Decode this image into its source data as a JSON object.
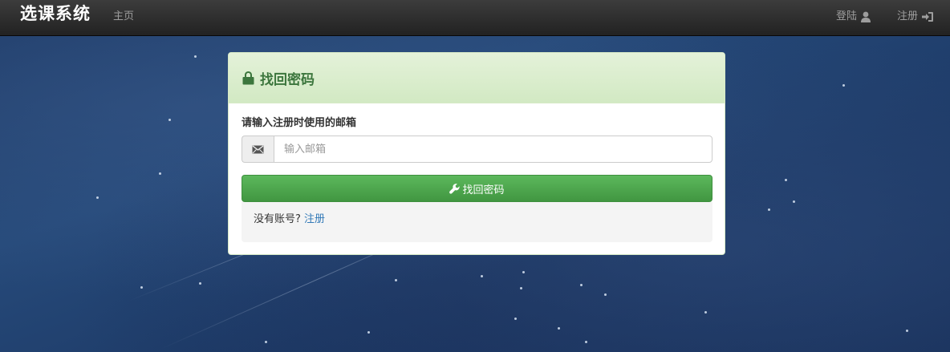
{
  "navbar": {
    "brand": "选课系统",
    "home": "主页",
    "login": "登陆",
    "register": "注册"
  },
  "panel": {
    "title": "找回密码",
    "email_label": "请输入注册时使用的邮箱",
    "email_placeholder": "输入邮箱",
    "email_value": "",
    "submit_label": "找回密码",
    "no_account_text": "没有账号?",
    "register_link": "注册"
  },
  "colors": {
    "navbar_bg": "#222222",
    "panel_heading_bg": "#dff0d8",
    "panel_title": "#3c763d",
    "submit_bg": "#5cb85c",
    "link": "#337ab7"
  },
  "icons": {
    "login": "user-icon",
    "register": "sign-in-icon",
    "panel": "lock-icon",
    "email": "envelope-icon",
    "submit": "wrench-icon"
  }
}
